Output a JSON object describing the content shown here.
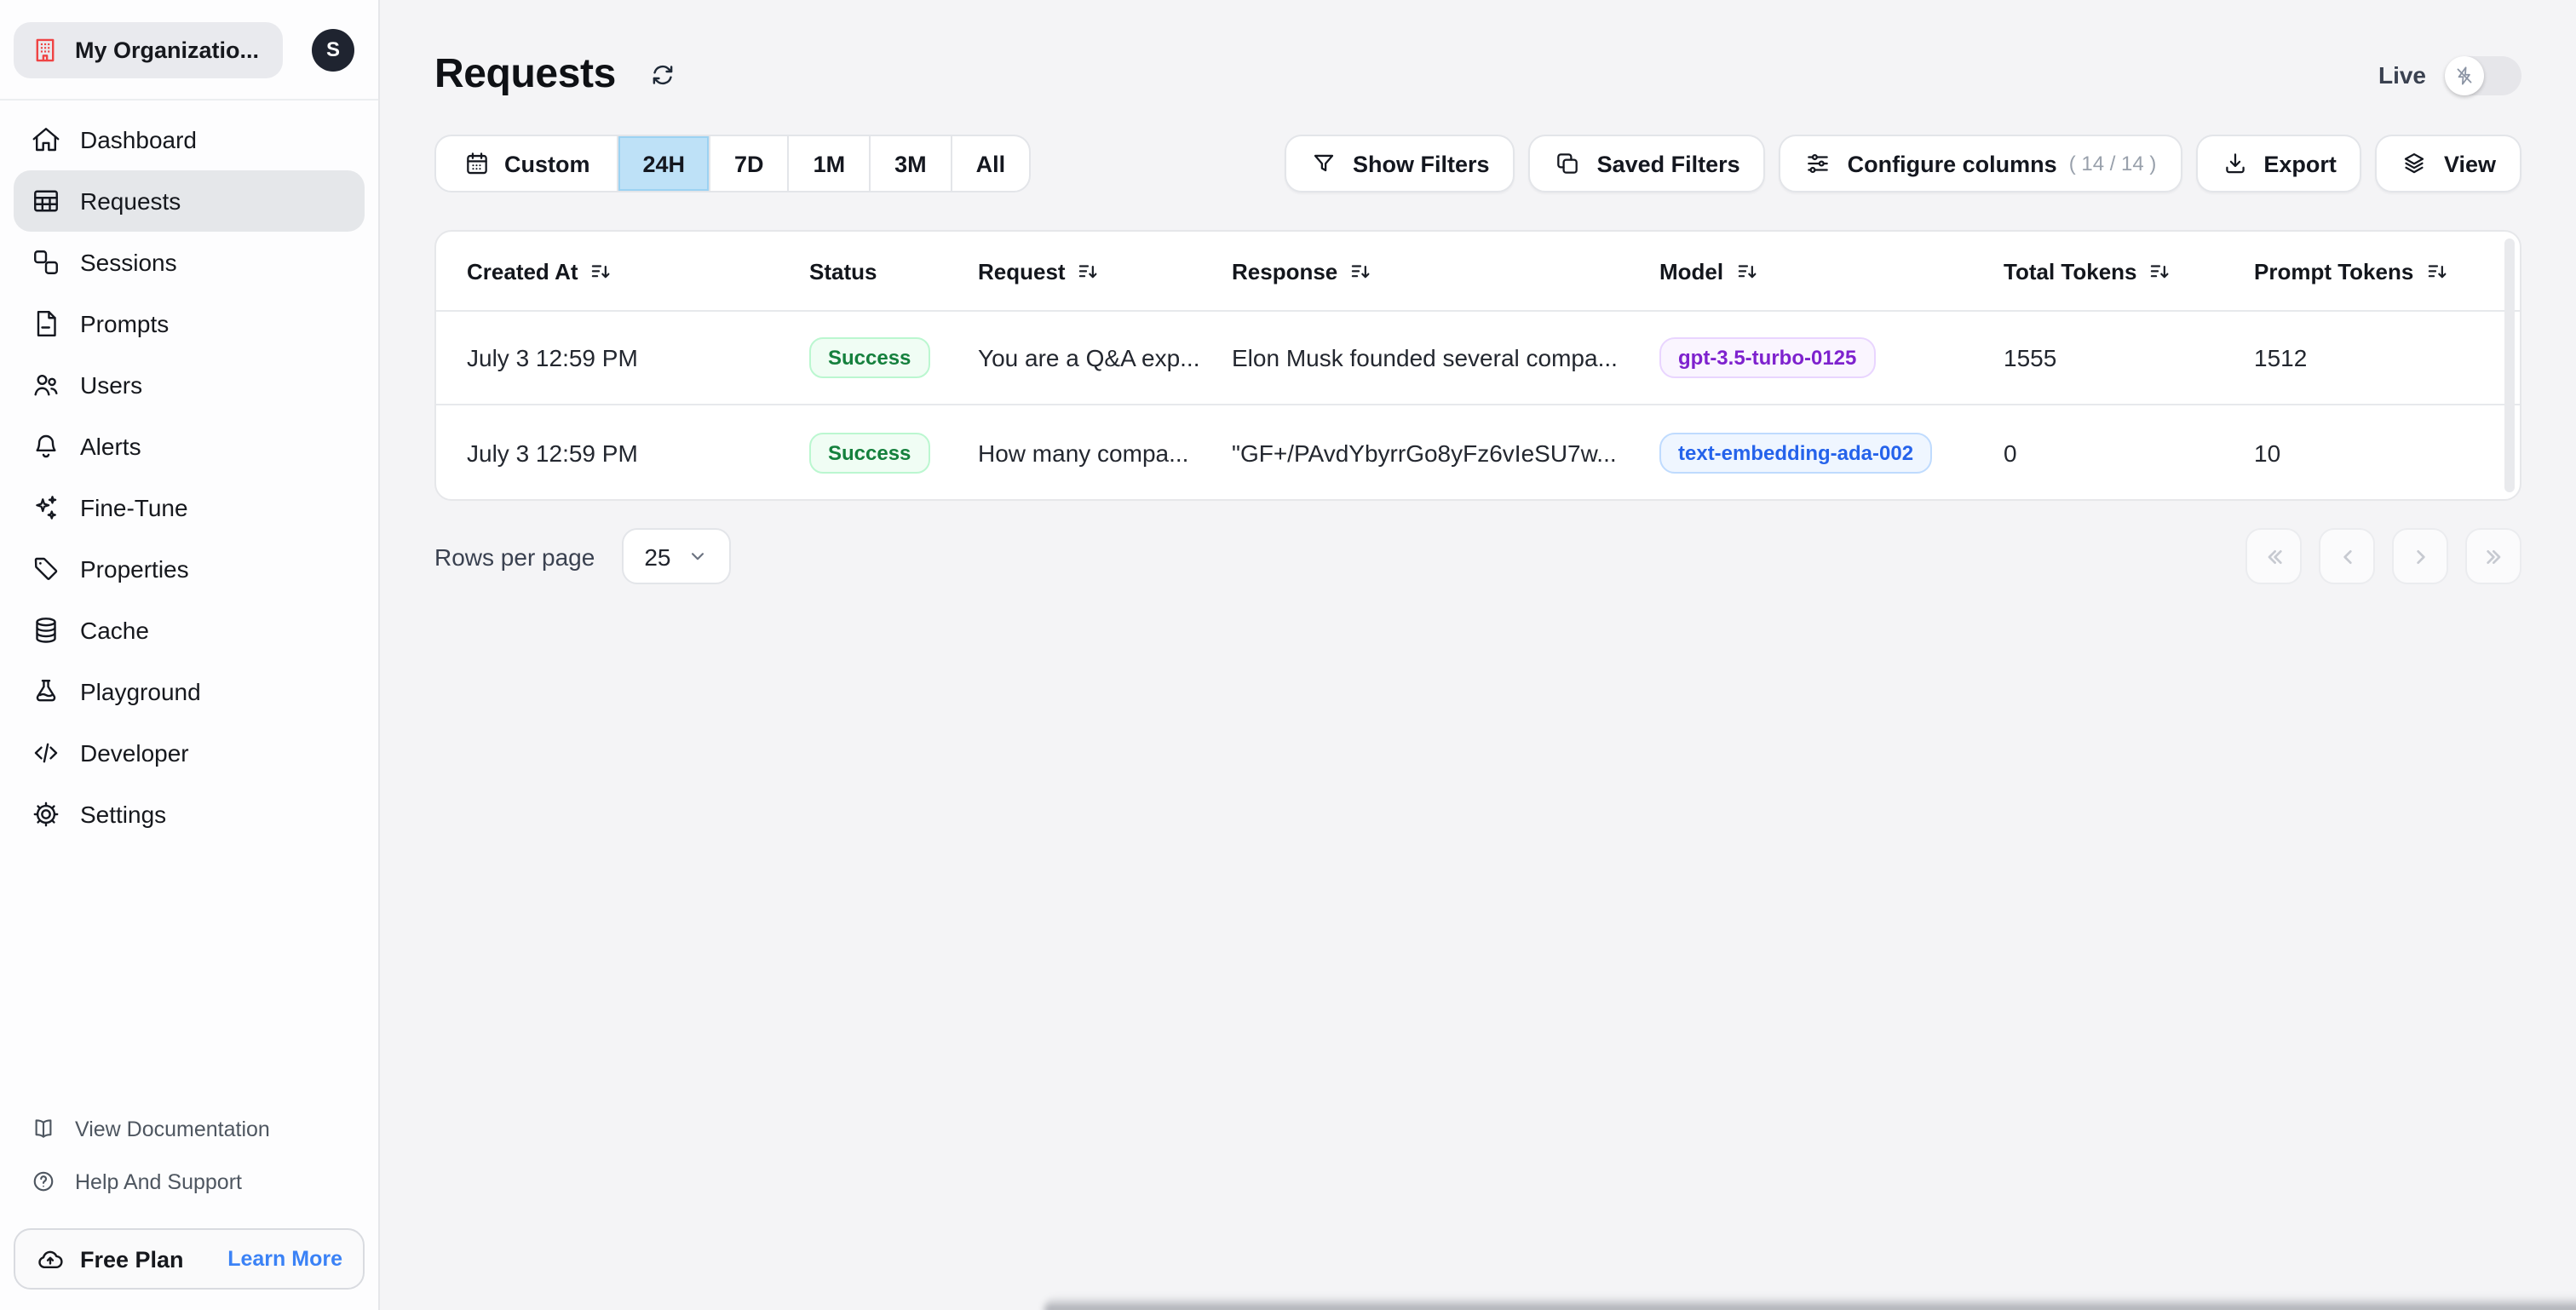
{
  "sidebar": {
    "org_name": "My Organizatio...",
    "avatar_initial": "S",
    "nav": [
      {
        "label": "Dashboard",
        "icon": "home-icon",
        "active": false
      },
      {
        "label": "Requests",
        "icon": "table-icon",
        "active": true
      },
      {
        "label": "Sessions",
        "icon": "sessions-icon",
        "active": false
      },
      {
        "label": "Prompts",
        "icon": "document-icon",
        "active": false
      },
      {
        "label": "Users",
        "icon": "users-icon",
        "active": false
      },
      {
        "label": "Alerts",
        "icon": "bell-icon",
        "active": false
      },
      {
        "label": "Fine-Tune",
        "icon": "sparkles-icon",
        "active": false
      },
      {
        "label": "Properties",
        "icon": "tag-icon",
        "active": false
      },
      {
        "label": "Cache",
        "icon": "database-icon",
        "active": false
      },
      {
        "label": "Playground",
        "icon": "beaker-icon",
        "active": false
      },
      {
        "label": "Developer",
        "icon": "code-icon",
        "active": false
      },
      {
        "label": "Settings",
        "icon": "gear-icon",
        "active": false
      }
    ],
    "footer_links": [
      {
        "label": "View Documentation",
        "icon": "book-icon"
      },
      {
        "label": "Help And Support",
        "icon": "question-icon"
      }
    ],
    "plan": {
      "name": "Free Plan",
      "action": "Learn More",
      "icon": "cloud-upload-icon"
    }
  },
  "header": {
    "title": "Requests",
    "live_label": "Live",
    "live_on": false
  },
  "toolbar": {
    "time_ranges": [
      {
        "label": "Custom",
        "selected": false
      },
      {
        "label": "24H",
        "selected": true
      },
      {
        "label": "7D",
        "selected": false
      },
      {
        "label": "1M",
        "selected": false
      },
      {
        "label": "3M",
        "selected": false
      },
      {
        "label": "All",
        "selected": false
      }
    ],
    "show_filters_label": "Show Filters",
    "saved_filters_label": "Saved Filters",
    "configure_columns_label": "Configure columns",
    "configure_columns_count": "( 14 / 14 )",
    "export_label": "Export",
    "view_label": "View"
  },
  "table": {
    "columns": [
      {
        "label": "Created At",
        "sortable": true
      },
      {
        "label": "Status",
        "sortable": false
      },
      {
        "label": "Request",
        "sortable": true
      },
      {
        "label": "Response",
        "sortable": true
      },
      {
        "label": "Model",
        "sortable": true
      },
      {
        "label": "Total Tokens",
        "sortable": true
      },
      {
        "label": "Prompt Tokens",
        "sortable": true
      }
    ],
    "rows": [
      {
        "created_at": "July 3 12:59 PM",
        "status": "Success",
        "request": "You are a Q&A exp...",
        "response": "Elon Musk founded several compa...",
        "model": "gpt-3.5-turbo-0125",
        "model_color": "purple",
        "total_tokens": "1555",
        "prompt_tokens": "1512"
      },
      {
        "created_at": "July 3 12:59 PM",
        "status": "Success",
        "request": "How many compa...",
        "response": "\"GF+/PAvdYbyrrGo8yFz6vIeSU7w...",
        "model": "text-embedding-ada-002",
        "model_color": "blue",
        "total_tokens": "0",
        "prompt_tokens": "10"
      }
    ]
  },
  "pagination": {
    "rows_per_page_label": "Rows per page",
    "rows_per_page_value": "25"
  },
  "colors": {
    "selected_range_bg": "#bee1f7",
    "success_green": "#15803d",
    "model_purple": "#7e22ce",
    "model_blue": "#2563eb",
    "brand_red": "#ef4444",
    "link_blue": "#3b82f6"
  }
}
